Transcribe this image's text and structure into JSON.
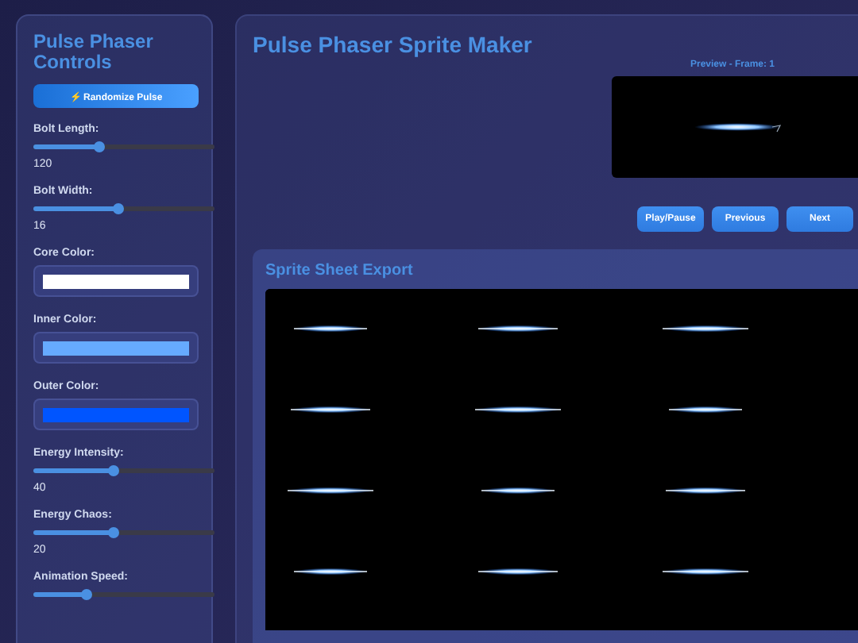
{
  "sidebar": {
    "title": "Pulse Phaser Controls",
    "randomize_button": "⚡ Randomize Pulse",
    "controls": [
      {
        "kind": "slider",
        "label": "Bolt Length:",
        "level": 0.36,
        "value": "120"
      },
      {
        "kind": "slider",
        "label": "Bolt Width:",
        "level": 0.47,
        "value": "16"
      },
      {
        "kind": "color",
        "label": "Core Color:",
        "color": "#ffffff"
      },
      {
        "kind": "color",
        "label": "Inner Color:",
        "color": "#66aaff"
      },
      {
        "kind": "color",
        "label": "Outer Color:",
        "color": "#0055ff"
      },
      {
        "kind": "slider",
        "label": "Energy Intensity:",
        "level": 0.44,
        "value": "40"
      },
      {
        "kind": "slider",
        "label": "Energy Chaos:",
        "level": 0.44,
        "value": "20"
      },
      {
        "kind": "slider",
        "label": "Animation Speed:",
        "level": 0.29
      }
    ]
  },
  "main": {
    "title": "Pulse Phaser Sprite Maker",
    "preview_label": "Preview - Frame: 1",
    "buttons": [
      "Play/Pause",
      "Previous",
      "Next"
    ],
    "export": {
      "title": "Sprite Sheet Export"
    }
  }
}
